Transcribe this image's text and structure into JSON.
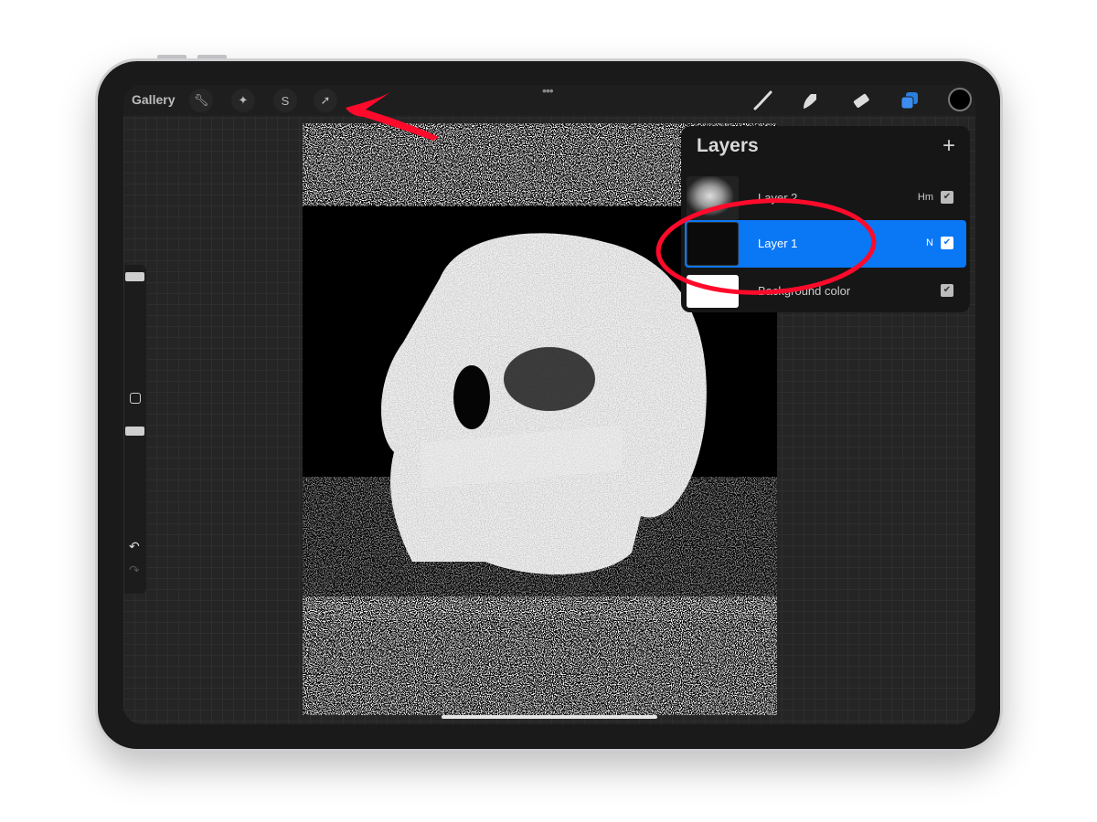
{
  "toolbar": {
    "gallery_label": "Gallery",
    "left_tools": [
      "wrench-icon",
      "magic-wand-icon",
      "selection-icon",
      "transform-arrow-icon"
    ],
    "right_tools": [
      "brush-icon",
      "smudge-icon",
      "eraser-icon",
      "layers-icon"
    ],
    "current_color": "#000000"
  },
  "layers_panel": {
    "title": "Layers",
    "add_symbol": "+",
    "layers": [
      {
        "name": "Layer 2",
        "blend": "Hm",
        "visible": true,
        "selected": false
      },
      {
        "name": "Layer 1",
        "blend": "N",
        "visible": true,
        "selected": true
      },
      {
        "name": "Background color",
        "blend": "",
        "visible": true,
        "selected": false
      }
    ]
  },
  "sidebar": {
    "undo": "↶",
    "redo": "↷",
    "modify": "□"
  },
  "annotations": {
    "color": "#ff0a2a"
  },
  "colors": {
    "accent": "#0a77f5"
  }
}
